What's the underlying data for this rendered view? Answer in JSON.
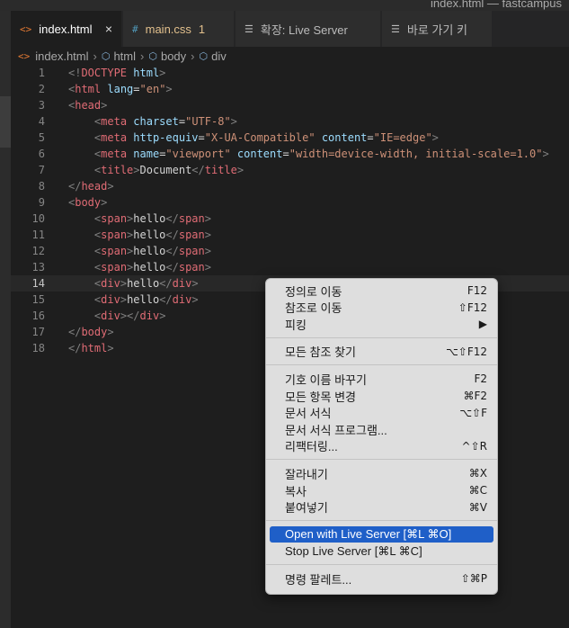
{
  "window": {
    "title": "index.html — fastcampus"
  },
  "tabs": [
    {
      "icon": "<>",
      "label": "index.html",
      "close": "×"
    },
    {
      "icon": "#",
      "label": "main.css",
      "badge": "1"
    },
    {
      "icon": "☰",
      "label": "확장: Live Server"
    },
    {
      "icon": "☰",
      "label": "바로 가기 키"
    }
  ],
  "breadcrumb": {
    "file": "index.html",
    "items": [
      "html",
      "body",
      "div"
    ]
  },
  "editor": {
    "current_line": 14,
    "line_numbers": [
      "1",
      "2",
      "3",
      "4",
      "5",
      "6",
      "7",
      "8",
      "9",
      "10",
      "11",
      "12",
      "13",
      "14",
      "15",
      "16",
      "17",
      "18"
    ],
    "lines": [
      [
        {
          "c": "t",
          "t": "<!"
        },
        {
          "c": "tag2",
          "t": "DOCTYPE"
        },
        {
          "c": "txt",
          "t": " "
        },
        {
          "c": "attr",
          "t": "html"
        },
        {
          "c": "t",
          "t": ">"
        }
      ],
      [
        {
          "c": "t",
          "t": "<"
        },
        {
          "c": "tag2",
          "t": "html"
        },
        {
          "c": "txt",
          "t": " "
        },
        {
          "c": "attr",
          "t": "lang"
        },
        {
          "c": "txt",
          "t": "="
        },
        {
          "c": "str",
          "t": "\"en\""
        },
        {
          "c": "t",
          "t": ">"
        }
      ],
      [
        {
          "c": "t",
          "t": "<"
        },
        {
          "c": "tag2",
          "t": "head"
        },
        {
          "c": "t",
          "t": ">"
        }
      ],
      [
        {
          "c": "txt",
          "t": "    "
        },
        {
          "c": "t",
          "t": "<"
        },
        {
          "c": "tag2",
          "t": "meta"
        },
        {
          "c": "txt",
          "t": " "
        },
        {
          "c": "attr",
          "t": "charset"
        },
        {
          "c": "txt",
          "t": "="
        },
        {
          "c": "str",
          "t": "\"UTF-8\""
        },
        {
          "c": "t",
          "t": ">"
        }
      ],
      [
        {
          "c": "txt",
          "t": "    "
        },
        {
          "c": "t",
          "t": "<"
        },
        {
          "c": "tag2",
          "t": "meta"
        },
        {
          "c": "txt",
          "t": " "
        },
        {
          "c": "attr",
          "t": "http-equiv"
        },
        {
          "c": "txt",
          "t": "="
        },
        {
          "c": "str",
          "t": "\"X-UA-Compatible\""
        },
        {
          "c": "txt",
          "t": " "
        },
        {
          "c": "attr",
          "t": "content"
        },
        {
          "c": "txt",
          "t": "="
        },
        {
          "c": "str",
          "t": "\"IE=edge\""
        },
        {
          "c": "t",
          "t": ">"
        }
      ],
      [
        {
          "c": "txt",
          "t": "    "
        },
        {
          "c": "t",
          "t": "<"
        },
        {
          "c": "tag2",
          "t": "meta"
        },
        {
          "c": "txt",
          "t": " "
        },
        {
          "c": "attr",
          "t": "name"
        },
        {
          "c": "txt",
          "t": "="
        },
        {
          "c": "str",
          "t": "\"viewport\""
        },
        {
          "c": "txt",
          "t": " "
        },
        {
          "c": "attr",
          "t": "content"
        },
        {
          "c": "txt",
          "t": "="
        },
        {
          "c": "str",
          "t": "\"width=device-width, initial-scale=1.0\""
        },
        {
          "c": "t",
          "t": ">"
        }
      ],
      [
        {
          "c": "txt",
          "t": "    "
        },
        {
          "c": "t",
          "t": "<"
        },
        {
          "c": "tag2",
          "t": "title"
        },
        {
          "c": "t",
          "t": ">"
        },
        {
          "c": "txt",
          "t": "Document"
        },
        {
          "c": "t",
          "t": "</"
        },
        {
          "c": "tag2",
          "t": "title"
        },
        {
          "c": "t",
          "t": ">"
        }
      ],
      [
        {
          "c": "t",
          "t": "</"
        },
        {
          "c": "tag2",
          "t": "head"
        },
        {
          "c": "t",
          "t": ">"
        }
      ],
      [
        {
          "c": "t",
          "t": "<"
        },
        {
          "c": "tag2",
          "t": "body"
        },
        {
          "c": "t",
          "t": ">"
        }
      ],
      [
        {
          "c": "txt",
          "t": "    "
        },
        {
          "c": "t",
          "t": "<"
        },
        {
          "c": "tag2",
          "t": "span"
        },
        {
          "c": "t",
          "t": ">"
        },
        {
          "c": "txt",
          "t": "hello"
        },
        {
          "c": "t",
          "t": "</"
        },
        {
          "c": "tag2",
          "t": "span"
        },
        {
          "c": "t",
          "t": ">"
        }
      ],
      [
        {
          "c": "txt",
          "t": "    "
        },
        {
          "c": "t",
          "t": "<"
        },
        {
          "c": "tag2",
          "t": "span"
        },
        {
          "c": "t",
          "t": ">"
        },
        {
          "c": "txt",
          "t": "hello"
        },
        {
          "c": "t",
          "t": "</"
        },
        {
          "c": "tag2",
          "t": "span"
        },
        {
          "c": "t",
          "t": ">"
        }
      ],
      [
        {
          "c": "txt",
          "t": "    "
        },
        {
          "c": "t",
          "t": "<"
        },
        {
          "c": "tag2",
          "t": "span"
        },
        {
          "c": "t",
          "t": ">"
        },
        {
          "c": "txt",
          "t": "hello"
        },
        {
          "c": "t",
          "t": "</"
        },
        {
          "c": "tag2",
          "t": "span"
        },
        {
          "c": "t",
          "t": ">"
        }
      ],
      [
        {
          "c": "txt",
          "t": "    "
        },
        {
          "c": "t",
          "t": "<"
        },
        {
          "c": "tag2",
          "t": "span"
        },
        {
          "c": "t",
          "t": ">"
        },
        {
          "c": "txt",
          "t": "hello"
        },
        {
          "c": "t",
          "t": "</"
        },
        {
          "c": "tag2",
          "t": "span"
        },
        {
          "c": "t",
          "t": ">"
        }
      ],
      [
        {
          "c": "txt",
          "t": "    "
        },
        {
          "c": "t",
          "t": "<"
        },
        {
          "c": "tag2",
          "t": "div"
        },
        {
          "c": "t",
          "t": ">"
        },
        {
          "c": "txt",
          "t": "hello"
        },
        {
          "c": "t",
          "t": "</"
        },
        {
          "c": "tag2",
          "t": "div"
        },
        {
          "c": "t",
          "t": ">"
        }
      ],
      [
        {
          "c": "txt",
          "t": "    "
        },
        {
          "c": "t",
          "t": "<"
        },
        {
          "c": "tag2",
          "t": "div"
        },
        {
          "c": "t",
          "t": ">"
        },
        {
          "c": "txt",
          "t": "hello"
        },
        {
          "c": "t",
          "t": "</"
        },
        {
          "c": "tag2",
          "t": "div"
        },
        {
          "c": "t",
          "t": ">"
        }
      ],
      [
        {
          "c": "txt",
          "t": "    "
        },
        {
          "c": "t",
          "t": "<"
        },
        {
          "c": "tag2",
          "t": "div"
        },
        {
          "c": "t",
          "t": "></"
        },
        {
          "c": "tag2",
          "t": "div"
        },
        {
          "c": "t",
          "t": ">"
        }
      ],
      [
        {
          "c": "t",
          "t": "</"
        },
        {
          "c": "tag2",
          "t": "body"
        },
        {
          "c": "t",
          "t": ">"
        }
      ],
      [
        {
          "c": "t",
          "t": "</"
        },
        {
          "c": "tag2",
          "t": "html"
        },
        {
          "c": "t",
          "t": ">"
        }
      ]
    ]
  },
  "context_menu": {
    "groups": [
      [
        {
          "label": "정의로 이동",
          "shortcut": "F12"
        },
        {
          "label": "참조로 이동",
          "shortcut": "⇧F12"
        },
        {
          "label": "피킹",
          "shortcut": "▶"
        }
      ],
      [
        {
          "label": "모든 참조 찾기",
          "shortcut": "⌥⇧F12"
        }
      ],
      [
        {
          "label": "기호 이름 바꾸기",
          "shortcut": "F2"
        },
        {
          "label": "모든 항목 변경",
          "shortcut": "⌘F2"
        },
        {
          "label": "문서 서식",
          "shortcut": "⌥⇧F"
        },
        {
          "label": "문서 서식 프로그램...",
          "shortcut": ""
        },
        {
          "label": "리팩터링...",
          "shortcut": "^⇧R"
        }
      ],
      [
        {
          "label": "잘라내기",
          "shortcut": "⌘X"
        },
        {
          "label": "복사",
          "shortcut": "⌘C"
        },
        {
          "label": "붙여넣기",
          "shortcut": "⌘V"
        }
      ],
      [
        {
          "label": "Open with Live Server [⌘L ⌘O]",
          "shortcut": "",
          "selected": true
        },
        {
          "label": "Stop Live Server [⌘L ⌘C]",
          "shortcut": ""
        }
      ],
      [
        {
          "label": "명령 팔레트...",
          "shortcut": "⇧⌘P"
        }
      ]
    ]
  }
}
